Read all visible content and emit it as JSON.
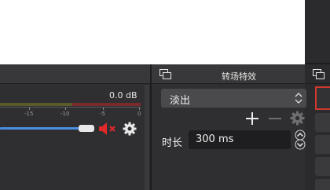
{
  "audio_mixer": {
    "level_db": "0.0 dB",
    "ticks": [
      "-15",
      "-10",
      "-5",
      "0"
    ],
    "volume_fraction": 0.82,
    "muted": true,
    "colors": {
      "slider": "#4a8fe0",
      "mute": "#e02a2a",
      "meter_green": "#5b5b2a",
      "meter_red": "#7a2a2a"
    }
  },
  "transitions": {
    "title": "转场特效",
    "selected": "淡出",
    "duration_label": "时长",
    "duration_value": "300 ms"
  },
  "colors": {
    "panel_bg": "#2f2f31",
    "accent_red": "#d0382e"
  }
}
